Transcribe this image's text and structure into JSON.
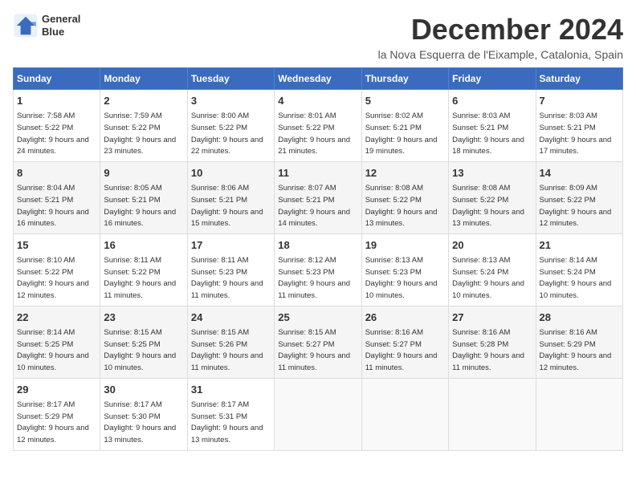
{
  "header": {
    "logo_line1": "General",
    "logo_line2": "Blue",
    "month_title": "December 2024",
    "subtitle": "la Nova Esquerra de l'Eixample, Catalonia, Spain"
  },
  "calendar": {
    "headers": [
      "Sunday",
      "Monday",
      "Tuesday",
      "Wednesday",
      "Thursday",
      "Friday",
      "Saturday"
    ],
    "weeks": [
      [
        {
          "day": "1",
          "sunrise": "7:58 AM",
          "sunset": "5:22 PM",
          "daylight": "9 hours and 24 minutes."
        },
        {
          "day": "2",
          "sunrise": "7:59 AM",
          "sunset": "5:22 PM",
          "daylight": "9 hours and 23 minutes."
        },
        {
          "day": "3",
          "sunrise": "8:00 AM",
          "sunset": "5:22 PM",
          "daylight": "9 hours and 22 minutes."
        },
        {
          "day": "4",
          "sunrise": "8:01 AM",
          "sunset": "5:22 PM",
          "daylight": "9 hours and 21 minutes."
        },
        {
          "day": "5",
          "sunrise": "8:02 AM",
          "sunset": "5:21 PM",
          "daylight": "9 hours and 19 minutes."
        },
        {
          "day": "6",
          "sunrise": "8:03 AM",
          "sunset": "5:21 PM",
          "daylight": "9 hours and 18 minutes."
        },
        {
          "day": "7",
          "sunrise": "8:03 AM",
          "sunset": "5:21 PM",
          "daylight": "9 hours and 17 minutes."
        }
      ],
      [
        {
          "day": "8",
          "sunrise": "8:04 AM",
          "sunset": "5:21 PM",
          "daylight": "9 hours and 16 minutes."
        },
        {
          "day": "9",
          "sunrise": "8:05 AM",
          "sunset": "5:21 PM",
          "daylight": "9 hours and 16 minutes."
        },
        {
          "day": "10",
          "sunrise": "8:06 AM",
          "sunset": "5:21 PM",
          "daylight": "9 hours and 15 minutes."
        },
        {
          "day": "11",
          "sunrise": "8:07 AM",
          "sunset": "5:21 PM",
          "daylight": "9 hours and 14 minutes."
        },
        {
          "day": "12",
          "sunrise": "8:08 AM",
          "sunset": "5:22 PM",
          "daylight": "9 hours and 13 minutes."
        },
        {
          "day": "13",
          "sunrise": "8:08 AM",
          "sunset": "5:22 PM",
          "daylight": "9 hours and 13 minutes."
        },
        {
          "day": "14",
          "sunrise": "8:09 AM",
          "sunset": "5:22 PM",
          "daylight": "9 hours and 12 minutes."
        }
      ],
      [
        {
          "day": "15",
          "sunrise": "8:10 AM",
          "sunset": "5:22 PM",
          "daylight": "9 hours and 12 minutes."
        },
        {
          "day": "16",
          "sunrise": "8:11 AM",
          "sunset": "5:22 PM",
          "daylight": "9 hours and 11 minutes."
        },
        {
          "day": "17",
          "sunrise": "8:11 AM",
          "sunset": "5:23 PM",
          "daylight": "9 hours and 11 minutes."
        },
        {
          "day": "18",
          "sunrise": "8:12 AM",
          "sunset": "5:23 PM",
          "daylight": "9 hours and 11 minutes."
        },
        {
          "day": "19",
          "sunrise": "8:13 AM",
          "sunset": "5:23 PM",
          "daylight": "9 hours and 10 minutes."
        },
        {
          "day": "20",
          "sunrise": "8:13 AM",
          "sunset": "5:24 PM",
          "daylight": "9 hours and 10 minutes."
        },
        {
          "day": "21",
          "sunrise": "8:14 AM",
          "sunset": "5:24 PM",
          "daylight": "9 hours and 10 minutes."
        }
      ],
      [
        {
          "day": "22",
          "sunrise": "8:14 AM",
          "sunset": "5:25 PM",
          "daylight": "9 hours and 10 minutes."
        },
        {
          "day": "23",
          "sunrise": "8:15 AM",
          "sunset": "5:25 PM",
          "daylight": "9 hours and 10 minutes."
        },
        {
          "day": "24",
          "sunrise": "8:15 AM",
          "sunset": "5:26 PM",
          "daylight": "9 hours and 11 minutes."
        },
        {
          "day": "25",
          "sunrise": "8:15 AM",
          "sunset": "5:27 PM",
          "daylight": "9 hours and 11 minutes."
        },
        {
          "day": "26",
          "sunrise": "8:16 AM",
          "sunset": "5:27 PM",
          "daylight": "9 hours and 11 minutes."
        },
        {
          "day": "27",
          "sunrise": "8:16 AM",
          "sunset": "5:28 PM",
          "daylight": "9 hours and 11 minutes."
        },
        {
          "day": "28",
          "sunrise": "8:16 AM",
          "sunset": "5:29 PM",
          "daylight": "9 hours and 12 minutes."
        }
      ],
      [
        {
          "day": "29",
          "sunrise": "8:17 AM",
          "sunset": "5:29 PM",
          "daylight": "9 hours and 12 minutes."
        },
        {
          "day": "30",
          "sunrise": "8:17 AM",
          "sunset": "5:30 PM",
          "daylight": "9 hours and 13 minutes."
        },
        {
          "day": "31",
          "sunrise": "8:17 AM",
          "sunset": "5:31 PM",
          "daylight": "9 hours and 13 minutes."
        },
        null,
        null,
        null,
        null
      ]
    ]
  }
}
